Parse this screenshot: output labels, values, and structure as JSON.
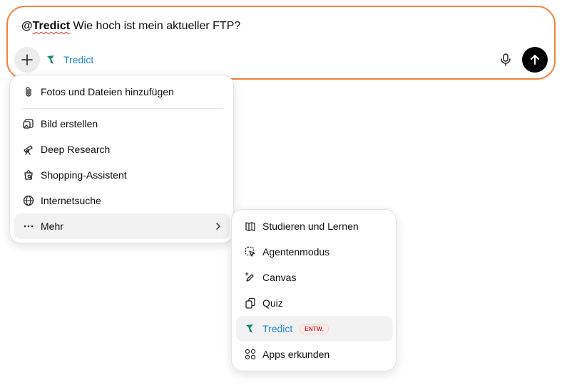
{
  "composer": {
    "mention": "@",
    "mention_name": "Tredict",
    "prompt_text": " Wie hoch ist mein aktueller FTP?",
    "app_chip_label": "Tredict"
  },
  "main_menu": {
    "items": [
      {
        "label": "Fotos und Dateien hinzufügen",
        "icon": "paperclip-icon"
      },
      {
        "label": "Bild erstellen",
        "icon": "image-create-icon"
      },
      {
        "label": "Deep Research",
        "icon": "telescope-icon"
      },
      {
        "label": "Shopping-Assistent",
        "icon": "shopping-bag-icon"
      },
      {
        "label": "Internetsuche",
        "icon": "globe-icon"
      },
      {
        "label": "Mehr",
        "icon": "more-dots-icon"
      }
    ]
  },
  "sub_menu": {
    "items": [
      {
        "label": "Studieren und Lernen",
        "icon": "book-icon"
      },
      {
        "label": "Agentenmodus",
        "icon": "agent-cursor-icon"
      },
      {
        "label": "Canvas",
        "icon": "pencil-sparkle-icon"
      },
      {
        "label": "Quiz",
        "icon": "cards-icon"
      },
      {
        "label": "Tredict",
        "icon": "tredict-logo-icon",
        "badge": "ENTW."
      },
      {
        "label": "Apps erkunden",
        "icon": "apps-grid-icon"
      }
    ]
  },
  "colors": {
    "accent_border": "#f0833c",
    "link_blue": "#1e88d6",
    "tredict_green": "#1b8a72",
    "badge_red": "#d32f2f"
  }
}
